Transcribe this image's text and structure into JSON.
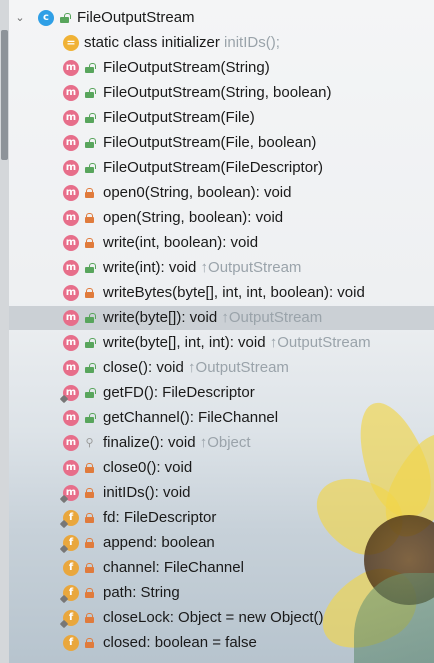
{
  "rows": [
    {
      "kind": "class",
      "label": "FileOutputStream",
      "extra": ""
    },
    {
      "kind": "init",
      "label": "static class initializer",
      "extra": "initIDs();"
    },
    {
      "kind": "m",
      "vis": "pub",
      "label": "FileOutputStream(String)",
      "extra": ""
    },
    {
      "kind": "m",
      "vis": "pub",
      "label": "FileOutputStream(String, boolean)",
      "extra": ""
    },
    {
      "kind": "m",
      "vis": "pub",
      "label": "FileOutputStream(File)",
      "extra": ""
    },
    {
      "kind": "m",
      "vis": "pub",
      "label": "FileOutputStream(File, boolean)",
      "extra": ""
    },
    {
      "kind": "m",
      "vis": "pub",
      "label": "FileOutputStream(FileDescriptor)",
      "extra": ""
    },
    {
      "kind": "m",
      "vis": "priv",
      "label": "open0(String, boolean): void",
      "extra": ""
    },
    {
      "kind": "m",
      "vis": "priv",
      "label": "open(String, boolean): void",
      "extra": ""
    },
    {
      "kind": "m",
      "vis": "priv",
      "label": "write(int, boolean): void",
      "extra": ""
    },
    {
      "kind": "m",
      "vis": "pub",
      "label": "write(int): void",
      "extra": "↑OutputStream"
    },
    {
      "kind": "m",
      "vis": "priv",
      "label": "writeBytes(byte[], int, int, boolean): void",
      "extra": ""
    },
    {
      "kind": "m",
      "vis": "pub",
      "label": "write(byte[]): void",
      "extra": "↑OutputStream",
      "selected": true
    },
    {
      "kind": "m",
      "vis": "pub",
      "label": "write(byte[], int, int): void",
      "extra": "↑OutputStream"
    },
    {
      "kind": "m",
      "vis": "pub",
      "label": "close(): void",
      "extra": "↑OutputStream"
    },
    {
      "kind": "m",
      "vis": "pub",
      "label": "getFD(): FileDescriptor",
      "extra": "",
      "pinned": true
    },
    {
      "kind": "m",
      "vis": "pub",
      "label": "getChannel(): FileChannel",
      "extra": ""
    },
    {
      "kind": "m",
      "vis": "prot",
      "label": "finalize(): void",
      "extra": "↑Object"
    },
    {
      "kind": "m",
      "vis": "priv",
      "label": "close0(): void",
      "extra": ""
    },
    {
      "kind": "m",
      "vis": "priv",
      "label": "initIDs(): void",
      "extra": "",
      "pinned": true
    },
    {
      "kind": "f",
      "vis": "priv",
      "label": "fd: FileDescriptor",
      "extra": "",
      "pinned": true
    },
    {
      "kind": "f",
      "vis": "priv",
      "label": "append: boolean",
      "extra": "",
      "pinned": true
    },
    {
      "kind": "f",
      "vis": "priv",
      "label": "channel: FileChannel",
      "extra": ""
    },
    {
      "kind": "f",
      "vis": "priv",
      "label": "path: String",
      "extra": "",
      "pinned": true
    },
    {
      "kind": "f",
      "vis": "priv",
      "label": "closeLock: Object = new Object()",
      "extra": "",
      "pinned": true
    },
    {
      "kind": "f",
      "vis": "priv",
      "label": "closed: boolean = false",
      "extra": ""
    }
  ],
  "badges": {
    "class": "c",
    "method": "m",
    "field": "f",
    "init": "="
  },
  "icons": {
    "expand": "chevron-down-icon"
  },
  "colors": {
    "method": "#e76e8a",
    "field": "#e9a73d",
    "class": "#2f9fe6",
    "public": "#58a55c",
    "private": "#e07b3c",
    "selection": "#c8cdd2"
  }
}
